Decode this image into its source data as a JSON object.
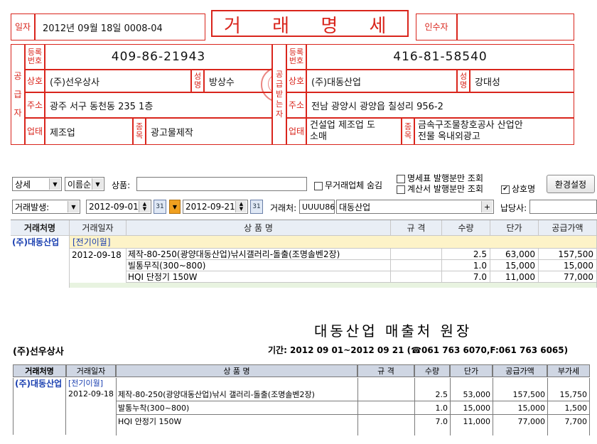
{
  "invoice": {
    "date_label": "일자",
    "date_value": "2012년 09월 18일   0008-04",
    "title": "거 래 명 세 표",
    "receiver_label": "인수자",
    "supplier_side_label": [
      "공",
      "급",
      "자"
    ],
    "buyer_side_label": [
      "공",
      "급",
      "받",
      "는",
      "자"
    ],
    "reg_label": "등록번호",
    "name_label": "상호",
    "rep_label": "성명",
    "addr_label": "주소",
    "biz_label": "업태",
    "item_label": "종목",
    "supplier": {
      "reg_no": "409-86-21943",
      "name": "(주)선우상사",
      "rep": "방상수",
      "address": "광주 서구 동천동 235 1층",
      "business": "제조업",
      "item": "광고물제작"
    },
    "buyer": {
      "reg_no": "416-81-58540",
      "name": "(주)대동산업",
      "rep": "강대성",
      "address": "전남 광양시 광양읍 칠성리 956-2",
      "business_1": "건설업 제조업 도",
      "business_2": "소매",
      "item_1": "금속구조물창호공사 산업안",
      "item_2": "전물 옥내외광고"
    }
  },
  "toolbar1": {
    "view_mode": "상세",
    "sort_mode": "이름순",
    "product_label": "상품:",
    "product_value": "",
    "hide_inactive_label": "무거래업체 숨김",
    "only_statement_label": "명세표 발행분만 조회",
    "only_invoice_label": "계산서 발행분만 조회",
    "company_name_label": "상호명",
    "settings_button": "환경설정"
  },
  "toolbar2": {
    "date_type": "거래발생:",
    "date_from": "2012-09-01",
    "date_to": "2012-09-21",
    "client_label": "거래처:",
    "client_code": "UUUU86",
    "client_name": "대동산업",
    "payer_label": "납당사:",
    "payer_value": ""
  },
  "grid": {
    "headers": [
      "거래처명",
      "거래일자",
      "상 품 명",
      "규 격",
      "수량",
      "단가",
      "공급가액"
    ],
    "client": "(주)대동산업",
    "carry_over": "[전기이월]",
    "date": "2012-09-18",
    "rows": [
      {
        "name": "제작-80-250(광양대동산업)낚시갤러리-돌출(조명솔벤2장)",
        "qty": "2.5",
        "price": "63,000",
        "supply": "157,500"
      },
      {
        "name": "빌통무직(300~800)",
        "qty": "1.0",
        "price": "15,000",
        "supply": "15,000"
      },
      {
        "name": "HQI 단정기 150W",
        "qty": "7.0",
        "price": "11,000",
        "supply": "77,000"
      }
    ]
  },
  "report": {
    "title": "대동산업 매출처 원장",
    "company": "(주)선우상사",
    "period": "기간: 2012 09 01~2012 09 21 (☎061 763 6070,F:061 763 6065)",
    "headers": [
      "거래처명",
      "거래일자",
      "상 품 명",
      "규 격",
      "수량",
      "단가",
      "공급가액",
      "부가세"
    ],
    "client": "(주)대동산업",
    "carry_over": "[전기이월]",
    "date": "2012-09-18",
    "rows": [
      {
        "name": "제작-80-250(광양대동산업)낚시 갤러리-돌출(조명솔벤2장)",
        "qty": "2.5",
        "price": "53,000",
        "supply": "157,500",
        "vat": "15,750"
      },
      {
        "name": "발통누착(300~800)",
        "qty": "1.0",
        "price": "15,000",
        "supply": "15,000",
        "vat": "1,500"
      },
      {
        "name": "HQI 안정기 150W",
        "qty": "7.0",
        "price": "11,000",
        "supply": "77,000",
        "vat": "7,700"
      }
    ]
  },
  "colors": {
    "invoice_red": "#d9251c",
    "grid_header": "#e9eef5",
    "report_header": "#cfd6e3"
  }
}
